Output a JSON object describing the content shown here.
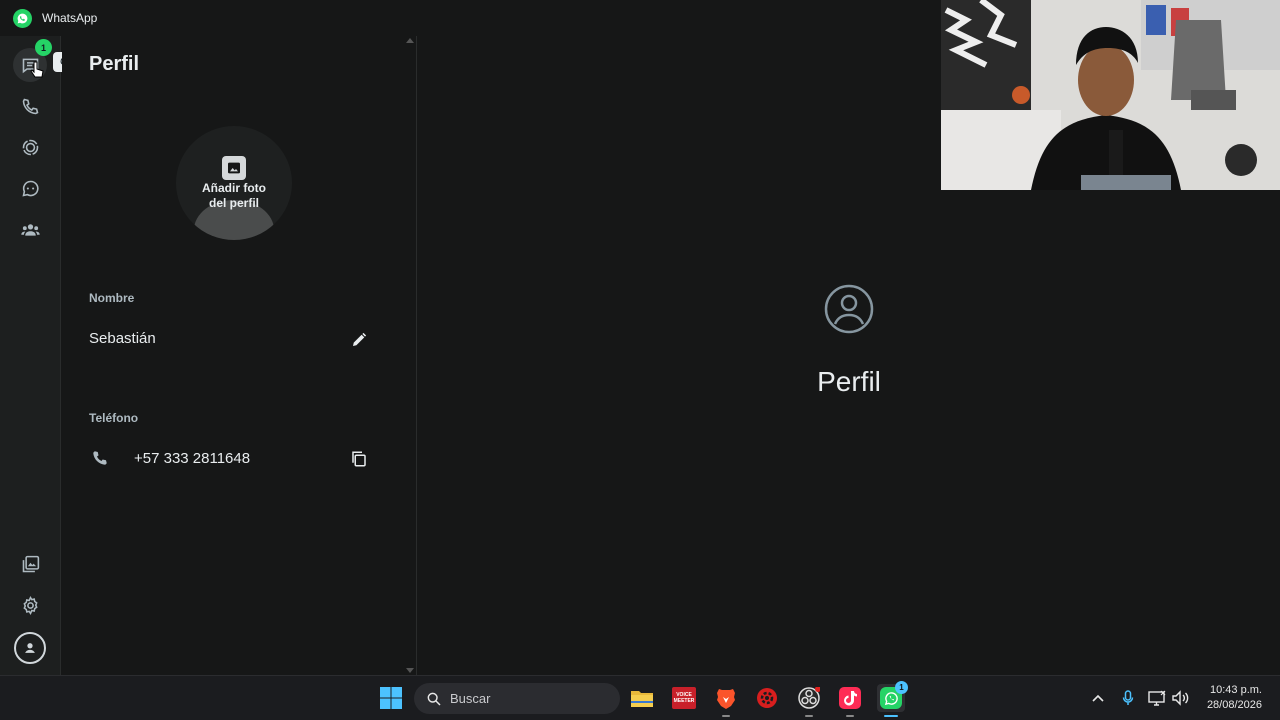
{
  "app": {
    "title": "WhatsApp"
  },
  "rail": {
    "chats_badge": "1",
    "tooltip": "Chats"
  },
  "profile_panel": {
    "title": "Perfil",
    "add_photo": "Añadir foto del perfil",
    "name_label": "Nombre",
    "name_value": "Sebastián",
    "phone_label": "Teléfono",
    "phone_value": "+57 333 2811648"
  },
  "main": {
    "title": "Perfil"
  },
  "taskbar": {
    "search_placeholder": "Buscar",
    "voicemeeter_label": "VOICE MEETER",
    "whatsapp_badge": "1",
    "time": "10:43 p.m.",
    "date": "28/08/2026"
  },
  "colors": {
    "accent": "#25d366",
    "background": "#161717",
    "rail": "#1d1f1f",
    "taskbar": "#1b1c1f"
  }
}
